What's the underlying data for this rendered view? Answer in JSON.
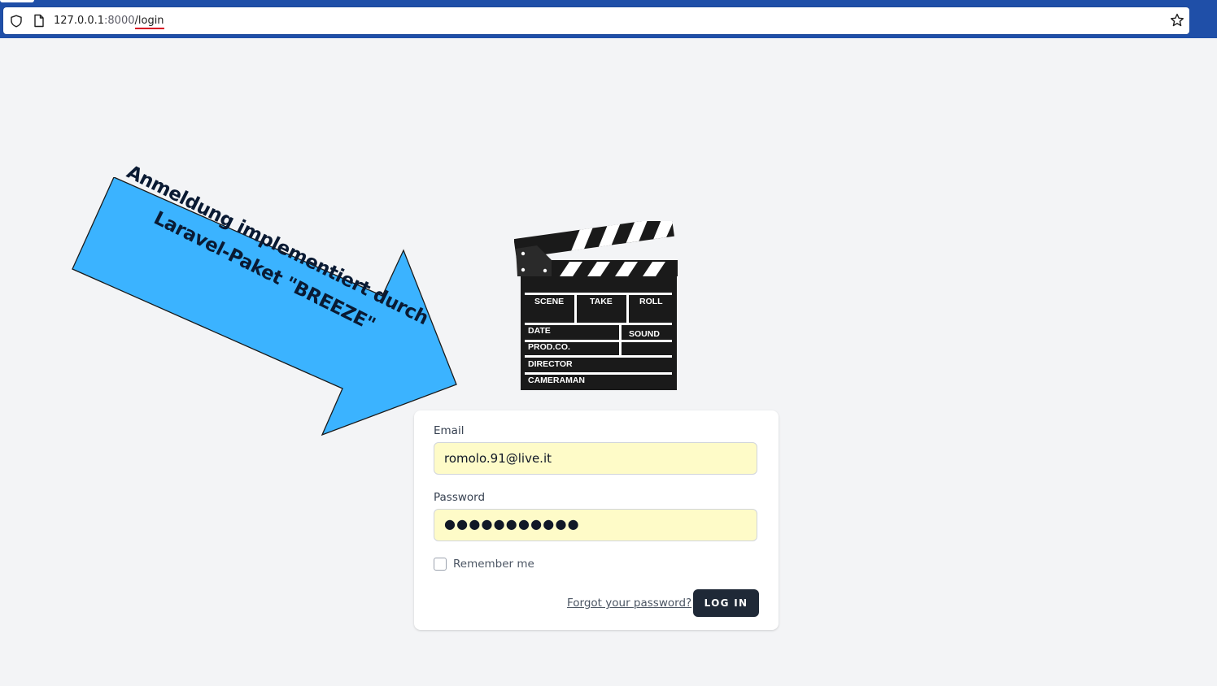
{
  "browser": {
    "url_host": "127.0.0.1",
    "url_port": ":8000",
    "url_path": "/login",
    "icons": [
      "shield-icon",
      "page-icon",
      "star-icon"
    ]
  },
  "annotation": {
    "line1": "Anmeldung implementiert durch",
    "line2": "Laravel-Paket \"BREEZE\"",
    "arrow_color": "#3bb3ff"
  },
  "logo": {
    "icon": "clapperboard-icon",
    "labels": {
      "scene": "SCENE",
      "take": "TAKE",
      "roll": "ROLL",
      "date": "DATE",
      "sound": "SOUND",
      "prodco": "PROD.CO.",
      "director": "DIRECTOR",
      "cameraman": "CAMERAMAN"
    }
  },
  "login_form": {
    "email_label": "Email",
    "email_value": "romolo.91@live.it",
    "password_label": "Password",
    "password_dots": "●●●●●●●●●●●",
    "remember_label": "Remember me",
    "remember_checked": false,
    "forgot_label": "Forgot your password?",
    "submit_label": "LOG IN",
    "autofill_color": "#fefbc8",
    "button_color": "#1f2937"
  }
}
